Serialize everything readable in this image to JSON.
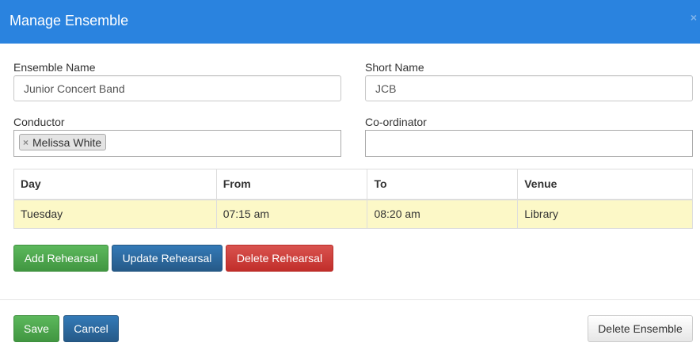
{
  "modal": {
    "title": "Manage Ensemble",
    "close_label": "×"
  },
  "form": {
    "ensemble_name": {
      "label": "Ensemble Name",
      "value": "Junior Concert Band"
    },
    "short_name": {
      "label": "Short Name",
      "value": "JCB"
    },
    "conductor": {
      "label": "Conductor",
      "tags": [
        "Melissa White"
      ],
      "remove_glyph": "×"
    },
    "coordinator": {
      "label": "Co-ordinator",
      "value": ""
    }
  },
  "rehearsals": {
    "columns": [
      "Day",
      "From",
      "To",
      "Venue"
    ],
    "rows": [
      [
        "Tuesday",
        "07:15 am",
        "08:20 am",
        "Library"
      ]
    ],
    "highlight_color": "#fcf8c7"
  },
  "actions": {
    "add": "Add Rehearsal",
    "update": "Update Rehearsal",
    "delete": "Delete Rehearsal"
  },
  "footer": {
    "save": "Save",
    "cancel": "Cancel",
    "delete_ensemble": "Delete Ensemble"
  },
  "colors": {
    "header": "#2a83df",
    "success": "#5cb85c",
    "primary": "#337ab7",
    "danger": "#d9534f"
  }
}
